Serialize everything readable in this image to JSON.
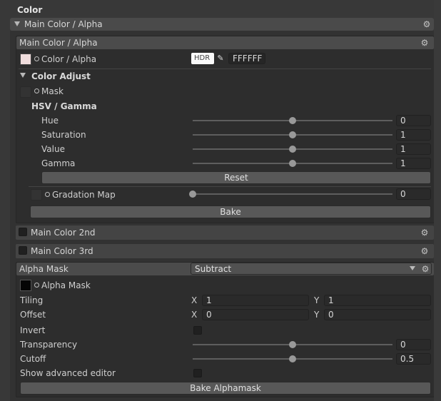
{
  "section_title": "Color",
  "outer_header": {
    "label": "Main Color / Alpha"
  },
  "main_color_panel": {
    "header": "Main Color / Alpha",
    "color_alpha": {
      "label": "Color / Alpha",
      "hdr": "HDR",
      "hex": "FFFFFF",
      "swatch_color": "#f1dede"
    },
    "color_adjust": {
      "label": "Color Adjust",
      "mask_label": "Mask",
      "hsv_title": "HSV / Gamma",
      "rows": [
        {
          "label": "Hue",
          "value": "0",
          "fraction": 0.5
        },
        {
          "label": "Saturation",
          "value": "1",
          "fraction": 0.5
        },
        {
          "label": "Value",
          "value": "1",
          "fraction": 0.5
        },
        {
          "label": "Gamma",
          "value": "1",
          "fraction": 0.5
        }
      ],
      "reset_label": "Reset",
      "gradation": {
        "label": "Gradation Map",
        "value": "0",
        "fraction": 0.0
      },
      "bake_label": "Bake"
    }
  },
  "main_color_2nd": {
    "label": "Main Color 2nd"
  },
  "main_color_3rd": {
    "label": "Main Color 3rd"
  },
  "alpha_mask_panel": {
    "header": "Alpha Mask",
    "mode": "Subtract",
    "alpha_mask_label": "Alpha Mask",
    "tiling": {
      "label": "Tiling",
      "x_label": "X",
      "x": "1",
      "y_label": "Y",
      "y": "1"
    },
    "offset": {
      "label": "Offset",
      "x_label": "X",
      "x": "0",
      "y_label": "Y",
      "y": "0"
    },
    "invert_label": "Invert",
    "transparency": {
      "label": "Transparency",
      "value": "0",
      "fraction": 0.5
    },
    "cutoff": {
      "label": "Cutoff",
      "value": "0.5",
      "fraction": 0.5
    },
    "advanced_label": "Show advanced editor",
    "bake_label": "Bake Alphamask"
  }
}
